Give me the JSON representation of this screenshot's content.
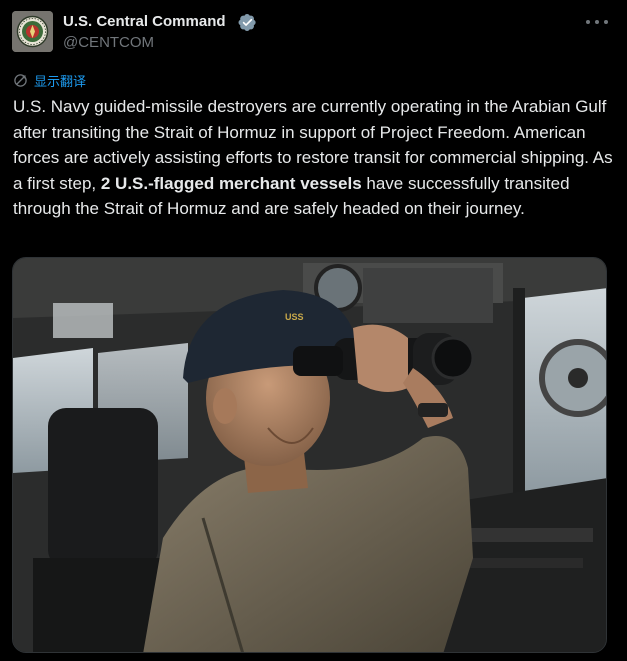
{
  "author": {
    "name": "U.S. Central Command",
    "handle": "@CENTCOM",
    "verified": true
  },
  "translate_label": "显示翻译",
  "tweet": {
    "text_before": "U.S. Navy guided-missile destroyers are currently operating in the Arabian Gulf after transiting the Strait of Hormuz in support of Project Freedom. American forces are actively assisting efforts to restore transit for commercial shipping. As a first step, ",
    "text_bold": "2 U.S.-flagged merchant vessels",
    "text_after": " have successfully transited through the Strait of Hormuz and are safely headed on their journey."
  },
  "colors": {
    "background": "#000000",
    "text": "#e7e9ea",
    "muted": "#71767b",
    "accent": "#1d9bf0"
  },
  "icons": {
    "more": "more-options-icon",
    "verified": "verified-badge-icon",
    "translate": "translate-icon"
  }
}
